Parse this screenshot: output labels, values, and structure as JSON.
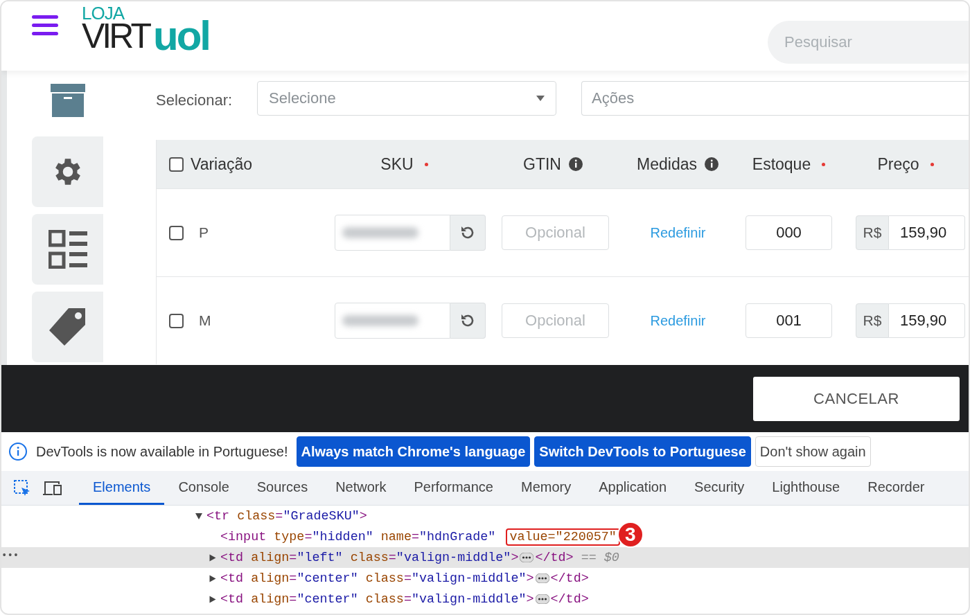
{
  "header": {
    "logo": {
      "top": "LOJA",
      "left": "VIRT",
      "right": "uol"
    },
    "search": {
      "placeholder": "Pesquisar"
    }
  },
  "sidebar": {
    "items": [
      {
        "kind": "box",
        "selected": true
      },
      {
        "kind": "gear",
        "selected": false
      },
      {
        "kind": "list",
        "selected": false
      },
      {
        "kind": "tag",
        "selected": false
      }
    ]
  },
  "toolbar": {
    "label": "Selecionar:",
    "select": {
      "placeholder": "Selecione"
    },
    "actions": {
      "placeholder": "Ações"
    }
  },
  "table": {
    "select_all": {
      "checked": false
    },
    "columns": [
      {
        "label": "Variação",
        "required": false,
        "info": false
      },
      {
        "label": "SKU",
        "required": true,
        "info": false
      },
      {
        "label": "GTIN",
        "required": false,
        "info": true
      },
      {
        "label": "Medidas",
        "required": false,
        "info": true
      },
      {
        "label": "Estoque",
        "required": true,
        "info": false
      },
      {
        "label": "Preço",
        "required": true,
        "info": false
      }
    ],
    "rows": [
      {
        "checked": false,
        "variation": "P",
        "gtin_placeholder": "Opcional",
        "measures_link": "Redefinir",
        "stock": "000",
        "currency": "R$",
        "price": "159,90"
      },
      {
        "checked": false,
        "variation": "M",
        "gtin_placeholder": "Opcional",
        "measures_link": "Redefinir",
        "stock": "001",
        "currency": "R$",
        "price": "159,90"
      }
    ]
  },
  "footer": {
    "cancel_button": "CANCELAR"
  },
  "devtools": {
    "infobar": {
      "message": "DevTools is now available in Portuguese!",
      "buttons": [
        {
          "label": "Always match Chrome's language",
          "primary": true
        },
        {
          "label": "Switch DevTools to Portuguese",
          "primary": true
        },
        {
          "label": "Don't show again",
          "primary": false
        }
      ]
    },
    "tabs": [
      {
        "label": "Elements",
        "selected": true
      },
      {
        "label": "Console",
        "selected": false
      },
      {
        "label": "Sources",
        "selected": false
      },
      {
        "label": "Network",
        "selected": false
      },
      {
        "label": "Performance",
        "selected": false
      },
      {
        "label": "Memory",
        "selected": false
      },
      {
        "label": "Application",
        "selected": false
      },
      {
        "label": "Security",
        "selected": false
      },
      {
        "label": "Lighthouse",
        "selected": false
      },
      {
        "label": "Recorder",
        "selected": false
      }
    ],
    "dom_tree": [
      {
        "kind": "node",
        "expanded": true,
        "selected": false,
        "parts": [
          {
            "kind": "tag",
            "text": "<tr"
          },
          {
            "kind": "attr",
            "text": " class"
          },
          {
            "kind": "tag",
            "text": "="
          },
          {
            "kind": "value",
            "text": "\"GradeSKU\""
          },
          {
            "kind": "tag",
            "text": ">"
          }
        ],
        "children": [
          {
            "kind": "leaf",
            "selected": false,
            "parts": [
              {
                "kind": "tag",
                "text": "<input"
              },
              {
                "kind": "attr",
                "text": " type"
              },
              {
                "kind": "tag",
                "text": "="
              },
              {
                "kind": "value",
                "text": "\"hidden\""
              },
              {
                "kind": "attr",
                "text": " name"
              },
              {
                "kind": "tag",
                "text": "="
              },
              {
                "kind": "value",
                "text": "\"hdnGrade\" "
              },
              {
                "kind": "highlight",
                "text": "value=\"220057\""
              }
            ],
            "callout": "3"
          },
          {
            "kind": "node",
            "expanded": false,
            "selected": true,
            "gutter": "•••",
            "parts": [
              {
                "kind": "tag",
                "text": "<td"
              },
              {
                "kind": "attr",
                "text": " align"
              },
              {
                "kind": "tag",
                "text": "="
              },
              {
                "kind": "value",
                "text": "\"left\""
              },
              {
                "kind": "attr",
                "text": " class"
              },
              {
                "kind": "tag",
                "text": "="
              },
              {
                "kind": "value",
                "text": "\"valign-middle\""
              },
              {
                "kind": "tag",
                "text": ">"
              },
              {
                "kind": "ellipsis"
              },
              {
                "kind": "tag",
                "text": "</td>"
              },
              {
                "kind": "dim",
                "text": " == $0"
              }
            ]
          },
          {
            "kind": "node",
            "expanded": false,
            "selected": false,
            "parts": [
              {
                "kind": "tag",
                "text": "<td"
              },
              {
                "kind": "attr",
                "text": " align"
              },
              {
                "kind": "tag",
                "text": "="
              },
              {
                "kind": "value",
                "text": "\"center\""
              },
              {
                "kind": "attr",
                "text": " class"
              },
              {
                "kind": "tag",
                "text": "="
              },
              {
                "kind": "value",
                "text": "\"valign-middle\""
              },
              {
                "kind": "tag",
                "text": ">"
              },
              {
                "kind": "ellipsis"
              },
              {
                "kind": "tag",
                "text": "</td>"
              }
            ]
          },
          {
            "kind": "node",
            "expanded": false,
            "selected": false,
            "parts": [
              {
                "kind": "tag",
                "text": "<td"
              },
              {
                "kind": "attr",
                "text": " align"
              },
              {
                "kind": "tag",
                "text": "="
              },
              {
                "kind": "value",
                "text": "\"center\""
              },
              {
                "kind": "attr",
                "text": " class"
              },
              {
                "kind": "tag",
                "text": "="
              },
              {
                "kind": "value",
                "text": "\"valign-middle\""
              },
              {
                "kind": "tag",
                "text": ">"
              },
              {
                "kind": "ellipsis"
              },
              {
                "kind": "tag",
                "text": "</td>"
              }
            ]
          }
        ]
      }
    ]
  }
}
